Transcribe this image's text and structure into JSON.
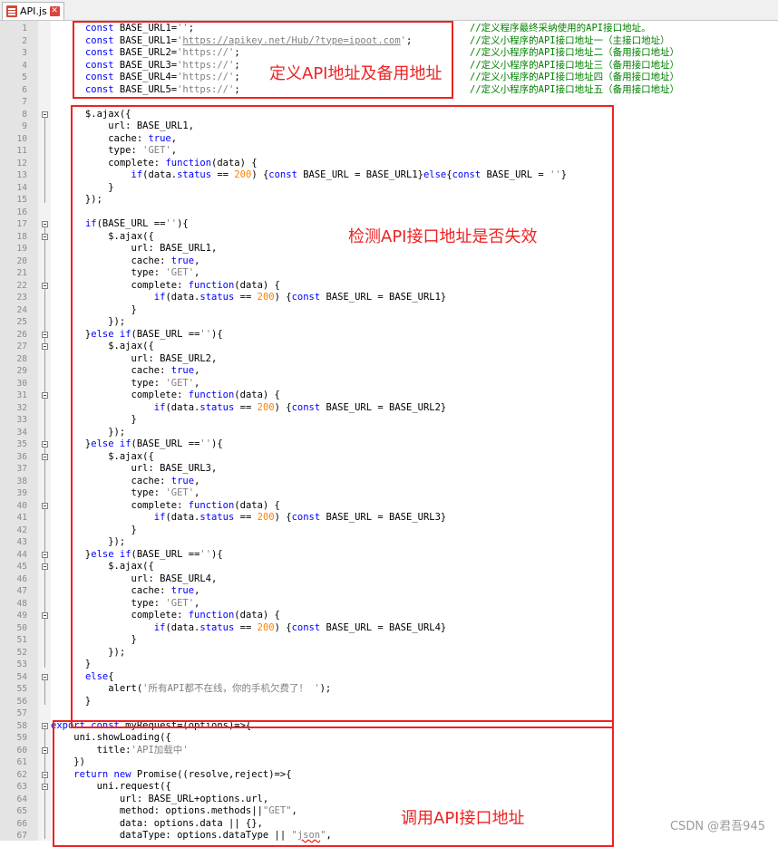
{
  "tab": {
    "label": "API.js"
  },
  "lines": [
    [
      {
        "t": "      "
      },
      {
        "t": "const",
        "c": "kw"
      },
      {
        "t": " BASE_URL1="
      },
      {
        "t": "''",
        "c": "str"
      },
      {
        "t": ";"
      }
    ],
    [
      {
        "t": "      "
      },
      {
        "t": "const",
        "c": "kw"
      },
      {
        "t": " BASE_URL1="
      },
      {
        "t": "'",
        "c": "str"
      },
      {
        "t": "https://apikey.net/Hub/?type=ipoot.com",
        "c": "lnk"
      },
      {
        "t": "'",
        "c": "str"
      },
      {
        "t": ";"
      }
    ],
    [
      {
        "t": "      "
      },
      {
        "t": "const",
        "c": "kw"
      },
      {
        "t": " BASE_URL2="
      },
      {
        "t": "'https://'",
        "c": "str"
      },
      {
        "t": ";"
      }
    ],
    [
      {
        "t": "      "
      },
      {
        "t": "const",
        "c": "kw"
      },
      {
        "t": " BASE_URL3="
      },
      {
        "t": "'https://'",
        "c": "str"
      },
      {
        "t": ";"
      }
    ],
    [
      {
        "t": "      "
      },
      {
        "t": "const",
        "c": "kw"
      },
      {
        "t": " BASE_URL4="
      },
      {
        "t": "'https://'",
        "c": "str"
      },
      {
        "t": ";"
      }
    ],
    [
      {
        "t": "      "
      },
      {
        "t": "const",
        "c": "kw"
      },
      {
        "t": " BASE_URL5="
      },
      {
        "t": "'https://'",
        "c": "str"
      },
      {
        "t": ";"
      }
    ],
    [],
    [
      {
        "t": "      $.ajax({"
      }
    ],
    [
      {
        "t": "          url: BASE_URL1,"
      }
    ],
    [
      {
        "t": "          cache: "
      },
      {
        "t": "true",
        "c": "kw"
      },
      {
        "t": ","
      }
    ],
    [
      {
        "t": "          type: "
      },
      {
        "t": "'GET'",
        "c": "str"
      },
      {
        "t": ","
      }
    ],
    [
      {
        "t": "          complete: "
      },
      {
        "t": "function",
        "c": "kw"
      },
      {
        "t": "(data) {"
      }
    ],
    [
      {
        "t": "              "
      },
      {
        "t": "if",
        "c": "kw"
      },
      {
        "t": "(data."
      },
      {
        "t": "status",
        "c": "kw"
      },
      {
        "t": " == "
      },
      {
        "t": "200",
        "c": "num"
      },
      {
        "t": ") {"
      },
      {
        "t": "const",
        "c": "kw"
      },
      {
        "t": " BASE_URL = BASE_URL1}"
      },
      {
        "t": "else",
        "c": "kw"
      },
      {
        "t": "{"
      },
      {
        "t": "const",
        "c": "kw"
      },
      {
        "t": " BASE_URL = "
      },
      {
        "t": "''",
        "c": "str"
      },
      {
        "t": "}"
      }
    ],
    [
      {
        "t": "          }"
      }
    ],
    [
      {
        "t": "      });"
      }
    ],
    [],
    [
      {
        "t": "      "
      },
      {
        "t": "if",
        "c": "kw"
      },
      {
        "t": "(BASE_URL =="
      },
      {
        "t": "''",
        "c": "str"
      },
      {
        "t": "){"
      }
    ],
    [
      {
        "t": "          $.ajax({"
      }
    ],
    [
      {
        "t": "              url: BASE_URL1,"
      }
    ],
    [
      {
        "t": "              cache: "
      },
      {
        "t": "true",
        "c": "kw"
      },
      {
        "t": ","
      }
    ],
    [
      {
        "t": "              type: "
      },
      {
        "t": "'GET'",
        "c": "str"
      },
      {
        "t": ","
      }
    ],
    [
      {
        "t": "              complete: "
      },
      {
        "t": "function",
        "c": "kw"
      },
      {
        "t": "(data) {"
      }
    ],
    [
      {
        "t": "                  "
      },
      {
        "t": "if",
        "c": "kw"
      },
      {
        "t": "(data."
      },
      {
        "t": "status",
        "c": "kw"
      },
      {
        "t": " == "
      },
      {
        "t": "200",
        "c": "num"
      },
      {
        "t": ") {"
      },
      {
        "t": "const",
        "c": "kw"
      },
      {
        "t": " BASE_URL = BASE_URL1}"
      }
    ],
    [
      {
        "t": "              }"
      }
    ],
    [
      {
        "t": "          });"
      }
    ],
    [
      {
        "t": "      }"
      },
      {
        "t": "else if",
        "c": "kw"
      },
      {
        "t": "(BASE_URL =="
      },
      {
        "t": "''",
        "c": "str"
      },
      {
        "t": "){"
      }
    ],
    [
      {
        "t": "          $.ajax({"
      }
    ],
    [
      {
        "t": "              url: BASE_URL2,"
      }
    ],
    [
      {
        "t": "              cache: "
      },
      {
        "t": "true",
        "c": "kw"
      },
      {
        "t": ","
      }
    ],
    [
      {
        "t": "              type: "
      },
      {
        "t": "'GET'",
        "c": "str"
      },
      {
        "t": ","
      }
    ],
    [
      {
        "t": "              complete: "
      },
      {
        "t": "function",
        "c": "kw"
      },
      {
        "t": "(data) {"
      }
    ],
    [
      {
        "t": "                  "
      },
      {
        "t": "if",
        "c": "kw"
      },
      {
        "t": "(data."
      },
      {
        "t": "status",
        "c": "kw"
      },
      {
        "t": " == "
      },
      {
        "t": "200",
        "c": "num"
      },
      {
        "t": ") {"
      },
      {
        "t": "const",
        "c": "kw"
      },
      {
        "t": " BASE_URL = BASE_URL2}"
      }
    ],
    [
      {
        "t": "              }"
      }
    ],
    [
      {
        "t": "          });"
      }
    ],
    [
      {
        "t": "      }"
      },
      {
        "t": "else if",
        "c": "kw"
      },
      {
        "t": "(BASE_URL =="
      },
      {
        "t": "''",
        "c": "str"
      },
      {
        "t": "){"
      }
    ],
    [
      {
        "t": "          $.ajax({"
      }
    ],
    [
      {
        "t": "              url: BASE_URL3,"
      }
    ],
    [
      {
        "t": "              cache: "
      },
      {
        "t": "true",
        "c": "kw"
      },
      {
        "t": ","
      }
    ],
    [
      {
        "t": "              type: "
      },
      {
        "t": "'GET'",
        "c": "str"
      },
      {
        "t": ","
      }
    ],
    [
      {
        "t": "              complete: "
      },
      {
        "t": "function",
        "c": "kw"
      },
      {
        "t": "(data) {"
      }
    ],
    [
      {
        "t": "                  "
      },
      {
        "t": "if",
        "c": "kw"
      },
      {
        "t": "(data."
      },
      {
        "t": "status",
        "c": "kw"
      },
      {
        "t": " == "
      },
      {
        "t": "200",
        "c": "num"
      },
      {
        "t": ") {"
      },
      {
        "t": "const",
        "c": "kw"
      },
      {
        "t": " BASE_URL = BASE_URL3}"
      }
    ],
    [
      {
        "t": "              }"
      }
    ],
    [
      {
        "t": "          });"
      }
    ],
    [
      {
        "t": "      }"
      },
      {
        "t": "else if",
        "c": "kw"
      },
      {
        "t": "(BASE_URL =="
      },
      {
        "t": "''",
        "c": "str"
      },
      {
        "t": "){"
      }
    ],
    [
      {
        "t": "          $.ajax({"
      }
    ],
    [
      {
        "t": "              url: BASE_URL4,"
      }
    ],
    [
      {
        "t": "              cache: "
      },
      {
        "t": "true",
        "c": "kw"
      },
      {
        "t": ","
      }
    ],
    [
      {
        "t": "              type: "
      },
      {
        "t": "'GET'",
        "c": "str"
      },
      {
        "t": ","
      }
    ],
    [
      {
        "t": "              complete: "
      },
      {
        "t": "function",
        "c": "kw"
      },
      {
        "t": "(data) {"
      }
    ],
    [
      {
        "t": "                  "
      },
      {
        "t": "if",
        "c": "kw"
      },
      {
        "t": "(data."
      },
      {
        "t": "status",
        "c": "kw"
      },
      {
        "t": " == "
      },
      {
        "t": "200",
        "c": "num"
      },
      {
        "t": ") {"
      },
      {
        "t": "const",
        "c": "kw"
      },
      {
        "t": " BASE_URL = BASE_URL4}"
      }
    ],
    [
      {
        "t": "              }"
      }
    ],
    [
      {
        "t": "          });"
      }
    ],
    [
      {
        "t": "      }"
      }
    ],
    [
      {
        "t": "      "
      },
      {
        "t": "else",
        "c": "kw"
      },
      {
        "t": "{"
      }
    ],
    [
      {
        "t": "          alert("
      },
      {
        "t": "'所有API都不在线，你的手机欠费了！ '",
        "c": "str"
      },
      {
        "t": ");"
      }
    ],
    [
      {
        "t": "      }"
      }
    ],
    [],
    [
      {
        "t": "export const",
        "c": "kw"
      },
      {
        "t": " myRequest=(options)=>{"
      }
    ],
    [
      {
        "t": "    uni.showLoading({"
      }
    ],
    [
      {
        "t": "        title:"
      },
      {
        "t": "'API加载中'",
        "c": "str"
      }
    ],
    [
      {
        "t": "    })"
      }
    ],
    [
      {
        "t": "    "
      },
      {
        "t": "return new",
        "c": "kw"
      },
      {
        "t": " Promise((resolve,reject)=>{"
      }
    ],
    [
      {
        "t": "        uni.request({"
      }
    ],
    [
      {
        "t": "            url: BASE_URL+options.url,"
      }
    ],
    [
      {
        "t": "            method: options.methods||"
      },
      {
        "t": "\"GET\"",
        "c": "str"
      },
      {
        "t": ","
      }
    ],
    [
      {
        "t": "            data: options.data || {},"
      }
    ],
    [
      {
        "t": "            dataType: options.dataType || "
      },
      {
        "t": "\"",
        "c": "str"
      },
      {
        "t": "json",
        "c": "str sq"
      },
      {
        "t": "\"",
        "c": "str"
      },
      {
        "t": ","
      }
    ]
  ],
  "comments": [
    "//定义程序最终采纳使用的API接口地址。",
    "//定义小程序的API接口地址一（主接口地址）",
    "//定义小程序的API接口地址二（备用接口地址）",
    "//定义小程序的API接口地址三（备用接口地址）",
    "//定义小程序的API接口地址四（备用接口地址）",
    "//定义小程序的API接口地址五（备用接口地址）"
  ],
  "annotations": [
    "定义API地址及备用地址",
    "检测API接口地址是否失效",
    "调用API接口地址"
  ],
  "watermark": "CSDN @君吾945"
}
